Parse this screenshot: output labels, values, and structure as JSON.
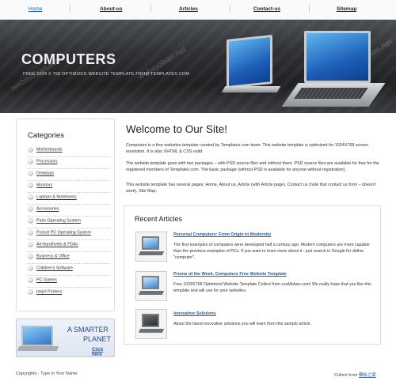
{
  "nav": {
    "items": [
      {
        "label": "Home"
      },
      {
        "label": "About-us"
      },
      {
        "label": "Articles"
      },
      {
        "label": "Contact-us"
      },
      {
        "label": "Sitemap"
      }
    ]
  },
  "banner": {
    "title": "COMPUTERS",
    "tagline": "FREE 1024 X 768 OPTIMIZED WEBSITE TEMPLATE FROM TEMPLATES.COM",
    "watermarks": [
      "webmoban.net",
      "webmoban.net",
      "webmoban.net"
    ]
  },
  "sidebar": {
    "heading": "Categories",
    "items": [
      {
        "label": "Motherboards"
      },
      {
        "label": "Processors"
      },
      {
        "label": "Desktops"
      },
      {
        "label": "Monitors"
      },
      {
        "label": "Laptops & Notebooks"
      },
      {
        "label": "Accessories"
      },
      {
        "label": "Palm Operating System"
      },
      {
        "label": "Pocket PC Operating System"
      },
      {
        "label": "All Handhelds & PDAs"
      },
      {
        "label": "Business & Office"
      },
      {
        "label": "Children's Software"
      },
      {
        "label": "PC Games"
      },
      {
        "label": "Inkjet Printers"
      }
    ]
  },
  "ad": {
    "line1": "A SMARTER",
    "line2": "PLANET",
    "link": "Click here"
  },
  "main": {
    "heading": "Welcome to Our Site!",
    "paragraphs": [
      "Computers is a free websites template created by Templates.com team. This website template is optimized for 1024X768 screen resolution. It is also XHTML & CSS valid.",
      "The website template goes with two packages – with PSD source files and without them. PSD source files are available for free for the registered members of Templates.com. The basic package (without PSD is available for anyone without registration).",
      "This website template has several pages: Home, About us, Article (with Article page), Contact us (note that contact us form – doesn't work), Site Map."
    ]
  },
  "recent": {
    "heading": "Recent Articles",
    "articles": [
      {
        "title": "Personal Computers: From Origin to Modernity",
        "text": "The first examples of computers were developed half a century ago. Modern computers are more capable than the previous examples of PCs. If you want to learn more about it - just search in Google for define \"computer\"."
      },
      {
        "title": "Promo of the Week. Computers Free Website Template",
        "text": "Free 1028X768 Optimized Website Template Collect from cssMoban.com! We really hope that you like this template and will use for your websites."
      },
      {
        "title": "Innovative Solutions",
        "text": "About the latest innovative solutions you will learn from this sample article."
      }
    ]
  },
  "footer": {
    "copyright": "Copyrights - Type in Your Name",
    "collect_prefix": "Collect from",
    "collect_link": "模板之家"
  },
  "colors": {
    "link": "#1b5fb4",
    "banner_dark": "#1f2022"
  }
}
